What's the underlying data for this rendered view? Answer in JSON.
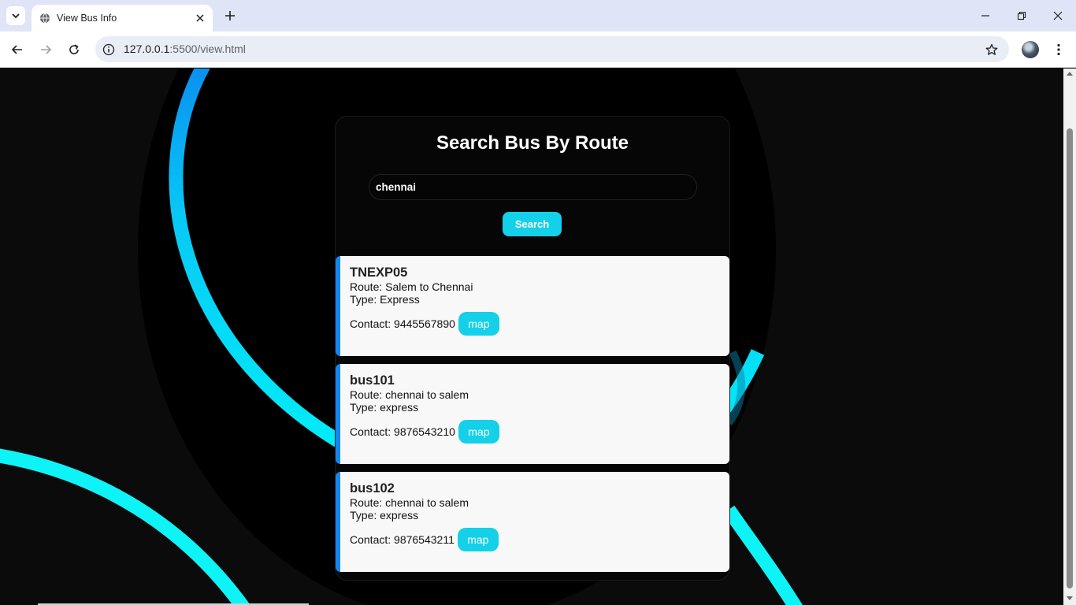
{
  "browser": {
    "tab_title": "View Bus Info",
    "url_host": "127.0.0.1",
    "url_rest": ":5500/view.html"
  },
  "page": {
    "heading": "Search Bus By Route",
    "search_value": "chennai",
    "search_button": "Search",
    "accent_color": "#14d0e8",
    "card_border_color": "#1486f0"
  },
  "results": [
    {
      "id": "TNEXP05",
      "route": "Route: Salem to Chennai",
      "type": "Type: Express",
      "contact": "Contact: 9445567890",
      "map_label": "map"
    },
    {
      "id": "bus101",
      "route": "Route: chennai to salem",
      "type": "Type: express",
      "contact": "Contact: 9876543210",
      "map_label": "map"
    },
    {
      "id": "bus102",
      "route": "Route: chennai to salem",
      "type": "Type: express",
      "contact": "Contact: 9876543211",
      "map_label": "map"
    }
  ]
}
